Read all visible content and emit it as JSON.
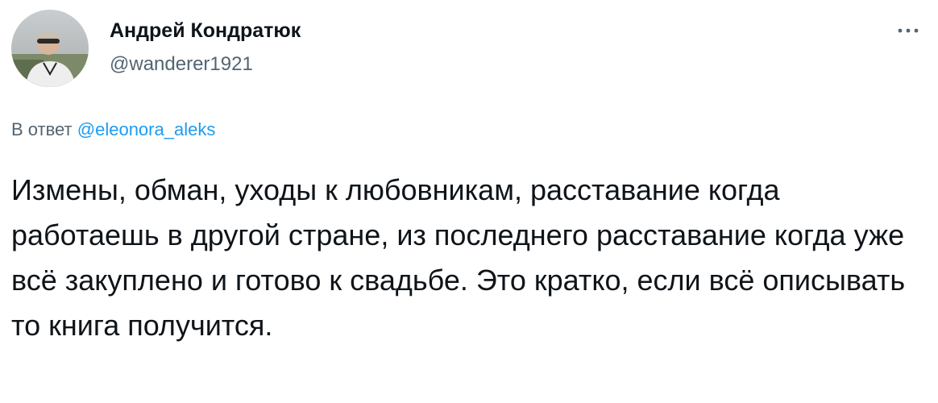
{
  "tweet": {
    "author": {
      "display_name": "Андрей Кондратюк",
      "handle": "@wanderer1921",
      "avatar_icon": "user-avatar-photo"
    },
    "more_icon": "more-horizontal-icon",
    "reply": {
      "prefix": "В ответ",
      "mention": "@eleonora_aleks"
    },
    "text": "Измены, обман, уходы к любовникам, расставание когда работаешь в другой стране, из последнего расставание когда уже всё закуплено и готово к свадьбе. Это кратко, если всё описывать то книга получится."
  },
  "colors": {
    "text_primary": "#0f1419",
    "text_secondary": "#536471",
    "accent_link": "#1d9bf0",
    "background": "#ffffff"
  }
}
